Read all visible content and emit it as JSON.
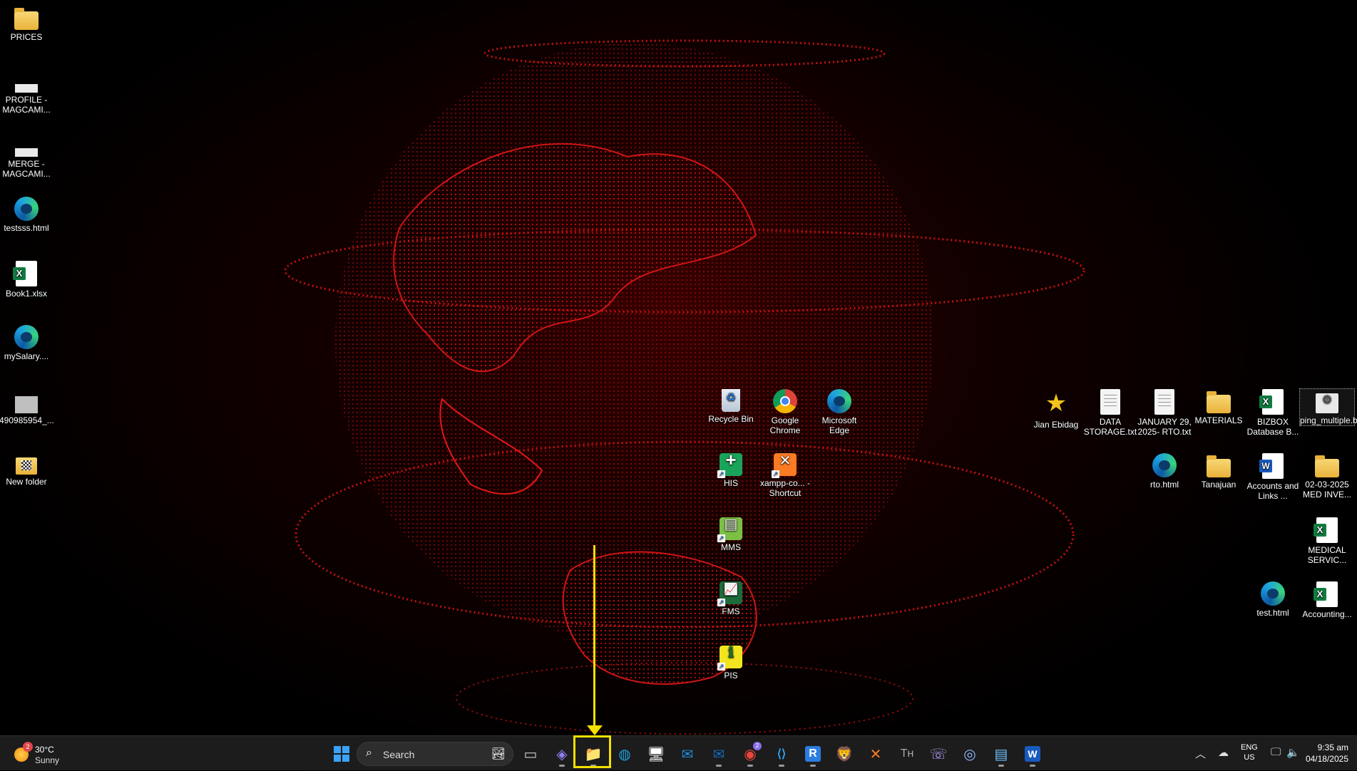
{
  "desktop": {
    "left_icons": [
      {
        "label": "PRICES",
        "icon": "folder-icon"
      },
      {
        "label": "PROFILE - MAGCAMI...",
        "icon": "image-thumbnail-icon"
      },
      {
        "label": "MERGE - MAGCAMI...",
        "icon": "image-thumbnail-icon"
      },
      {
        "label": "testsss.html",
        "icon": "edge-html-icon"
      },
      {
        "label": "Book1.xlsx",
        "icon": "excel-file-icon"
      },
      {
        "label": "mySalary....",
        "icon": "edge-html-icon"
      },
      {
        "label": "490985954_...",
        "icon": "image-thumbnail-icon"
      },
      {
        "label": "New folder",
        "icon": "folder-icon"
      }
    ],
    "center_icons": [
      {
        "label": "Recycle Bin",
        "icon": "recycle-bin-icon"
      },
      {
        "label": "Google Chrome",
        "icon": "chrome-icon"
      },
      {
        "label": "Microsoft Edge",
        "icon": "edge-icon"
      },
      {
        "label": "HIS",
        "icon": "his-app-icon"
      },
      {
        "label": "xampp-co... - Shortcut",
        "icon": "xampp-icon"
      },
      {
        "label": "MMS",
        "icon": "mms-app-icon"
      },
      {
        "label": "FMS",
        "icon": "fms-app-icon"
      },
      {
        "label": "PIS",
        "icon": "pis-app-icon"
      }
    ],
    "right_icons": [
      {
        "label": "Jian Ebidag",
        "icon": "star-icon"
      },
      {
        "label": "DATA STORAGE.txt",
        "icon": "text-file-icon"
      },
      {
        "label": "JANUARY 29, 2025- RTO.txt",
        "icon": "text-file-icon"
      },
      {
        "label": "MATERIALS",
        "icon": "folder-icon"
      },
      {
        "label": "BIZBOX Database B...",
        "icon": "excel-file-icon"
      },
      {
        "label": "ping_multiple.bat",
        "icon": "batch-file-icon"
      },
      {
        "label": "rto.html",
        "icon": "edge-html-icon"
      },
      {
        "label": "Tanajuan",
        "icon": "folder-icon"
      },
      {
        "label": "Accounts and Links ...",
        "icon": "word-file-icon"
      },
      {
        "label": "02-03-2025 MED INVE...",
        "icon": "folder-icon"
      },
      {
        "label": "MEDICAL SERVIC...",
        "icon": "excel-file-icon"
      },
      {
        "label": "test.html",
        "icon": "edge-html-icon"
      },
      {
        "label": "Accounting...",
        "icon": "excel-file-icon"
      }
    ]
  },
  "annotation": {
    "color": "#f2e000",
    "target": "file-explorer-taskbar-button"
  },
  "taskbar": {
    "weather": {
      "badge": "2",
      "temp": "30°C",
      "condition": "Sunny"
    },
    "search": {
      "placeholder": "Search"
    },
    "apps": [
      {
        "name": "task-view",
        "glyph": "▭"
      },
      {
        "name": "microsoft-365-copilot",
        "glyph": "◈"
      },
      {
        "name": "file-explorer",
        "glyph": "📁"
      },
      {
        "name": "microsoft-edge",
        "glyph": "◍"
      },
      {
        "name": "remote-desktop",
        "glyph": "🖥"
      },
      {
        "name": "outlook-new",
        "glyph": "✉"
      },
      {
        "name": "outlook-classic",
        "glyph": "✉"
      },
      {
        "name": "google-chrome",
        "glyph": "◉"
      },
      {
        "name": "visual-studio-code",
        "glyph": "⟨⟩"
      },
      {
        "name": "rstudio",
        "glyph": "R"
      },
      {
        "name": "brave",
        "glyph": "🦁"
      },
      {
        "name": "xampp",
        "glyph": "✕"
      },
      {
        "name": "typora",
        "glyph": "Tʜ"
      },
      {
        "name": "viber",
        "glyph": "☏"
      },
      {
        "name": "camera",
        "glyph": "◎"
      },
      {
        "name": "notepad",
        "glyph": "▤"
      },
      {
        "name": "microsoft-word",
        "glyph": "W"
      }
    ],
    "chrome_badge": "2",
    "tray": {
      "lang_line1": "ENG",
      "lang_line2": "US",
      "time": "9:35 am",
      "date": "04/18/2025"
    }
  },
  "colors": {
    "globe": "#d01010",
    "taskbar": "#1c1c1c",
    "highlight": "#f2e000"
  }
}
